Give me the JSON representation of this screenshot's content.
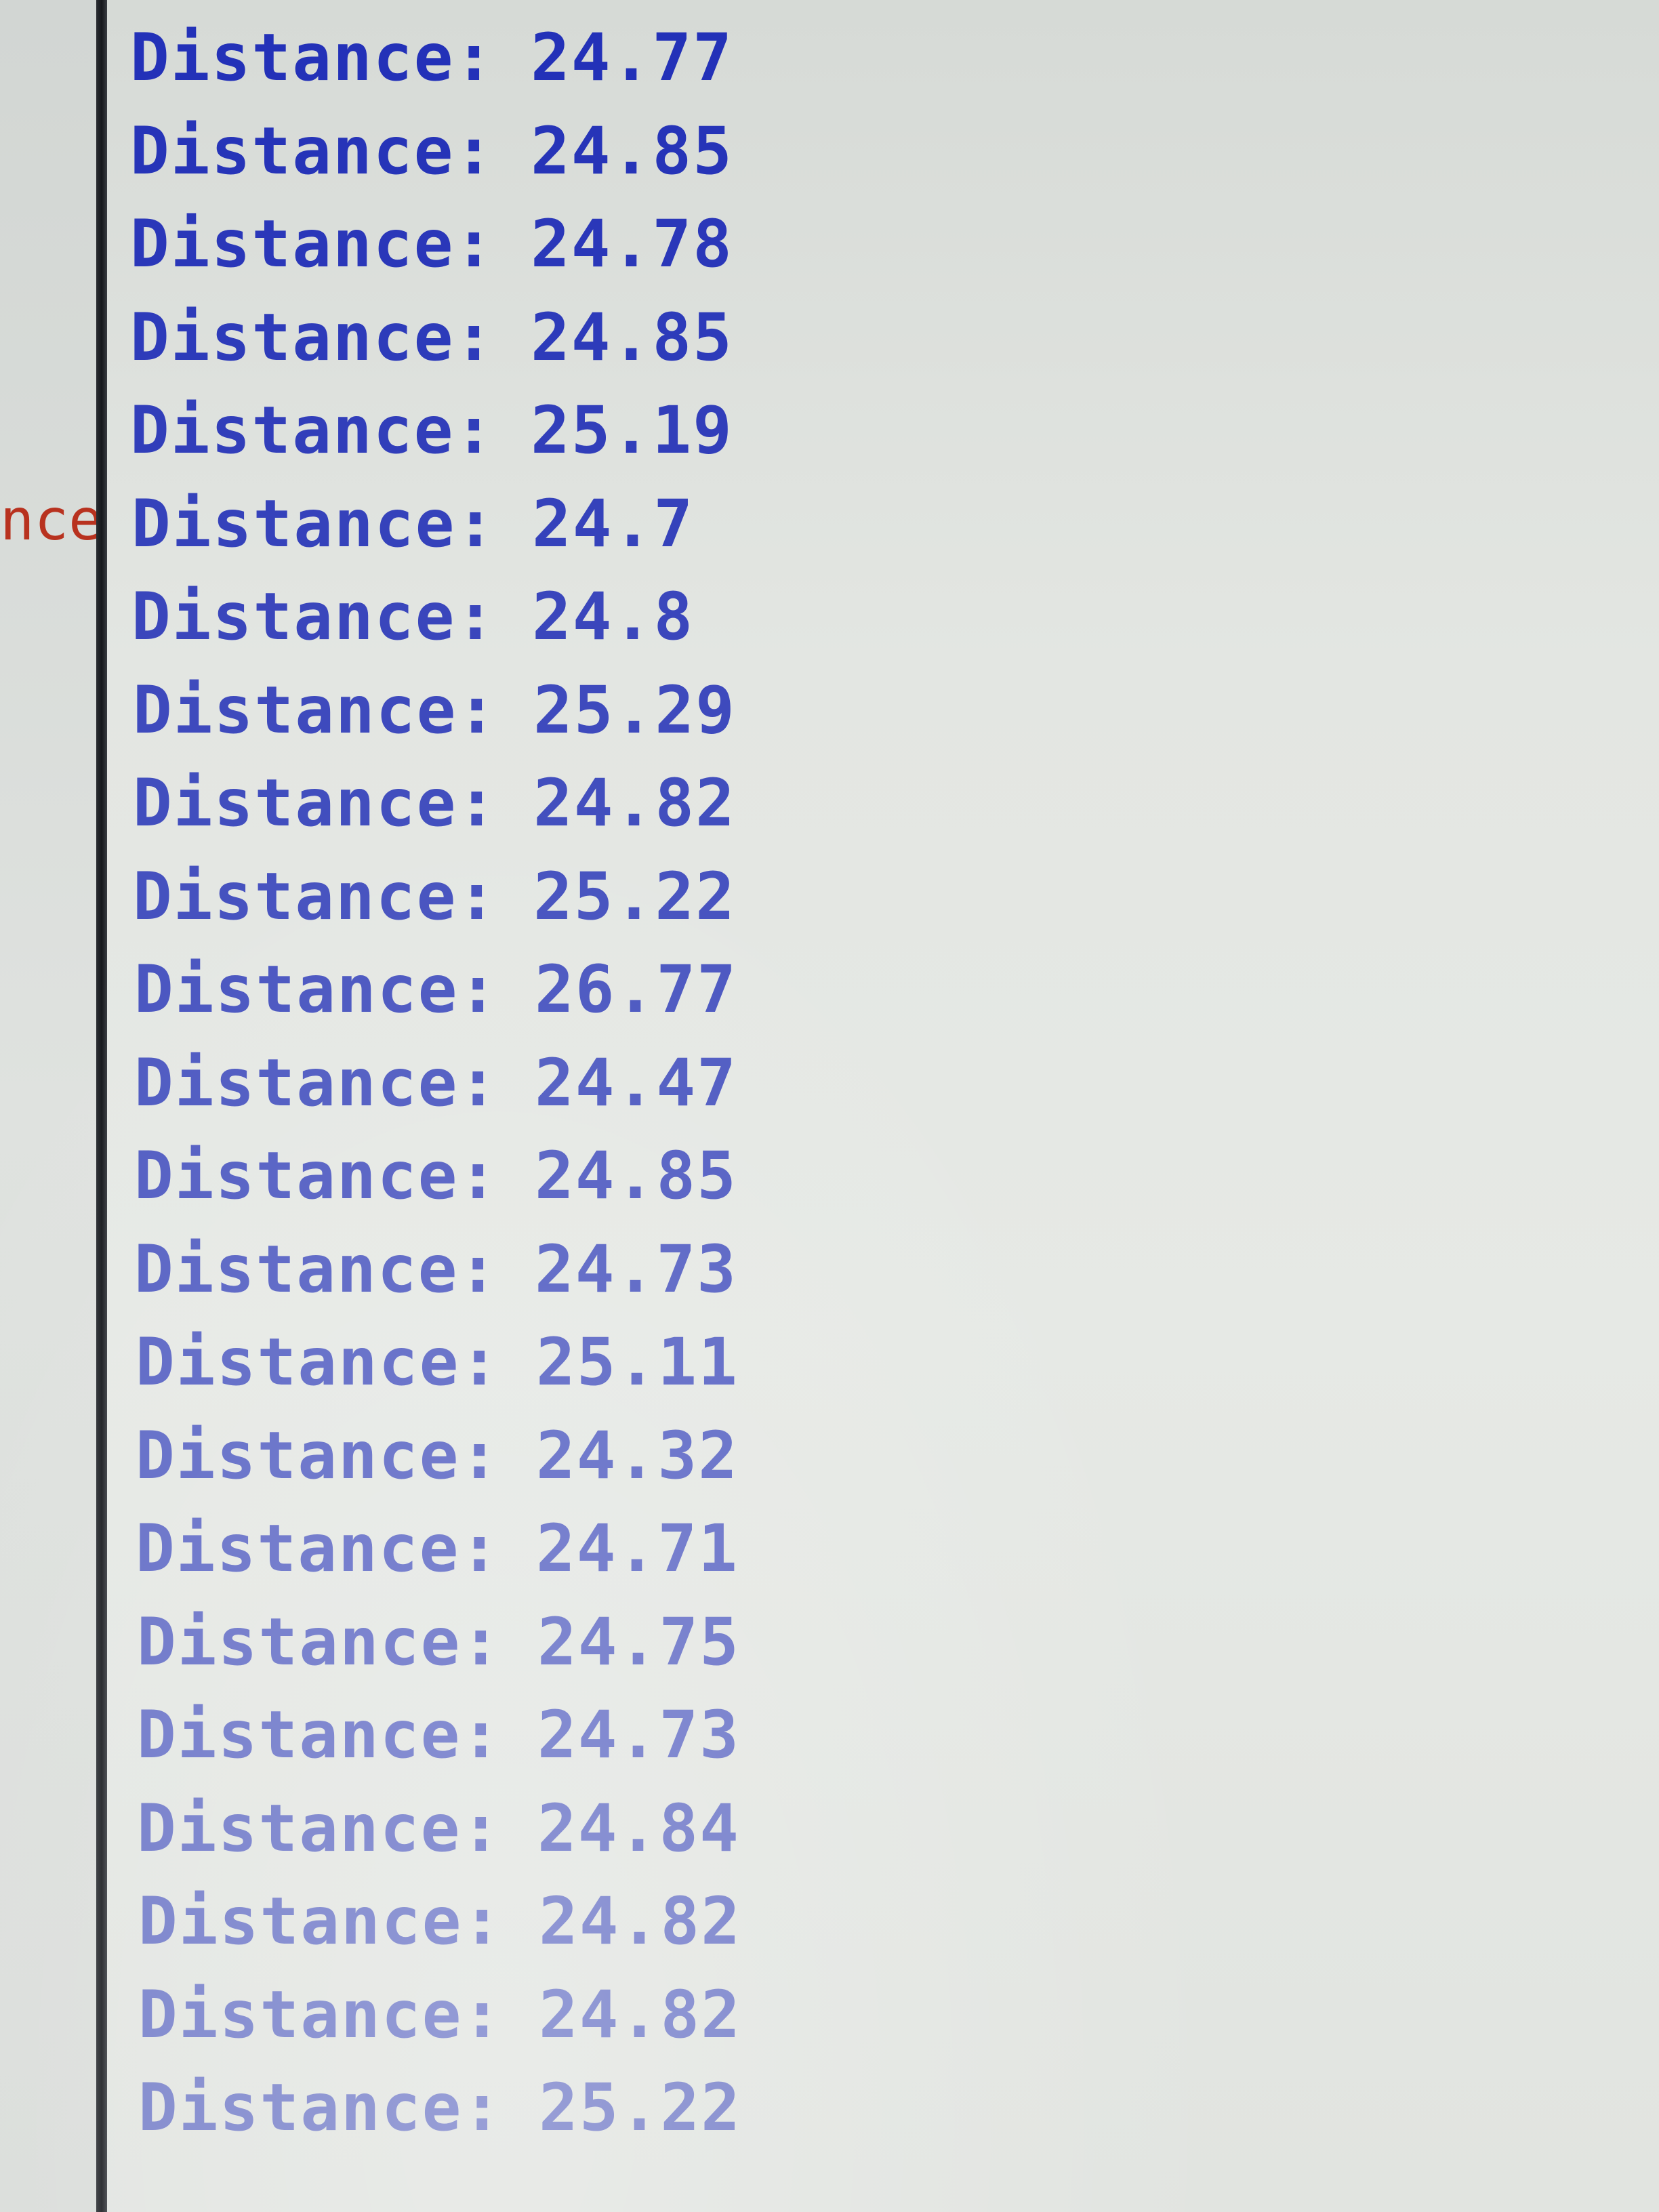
{
  "left_panel": {
    "partial_text": "nce"
  },
  "console": {
    "cutoff_line": "Dista",
    "label": "Distance:",
    "lines": [
      {
        "label": "Distance:",
        "value": "24.77"
      },
      {
        "label": "Distance:",
        "value": "24.85"
      },
      {
        "label": "Distance:",
        "value": "24.78"
      },
      {
        "label": "Distance:",
        "value": "24.85"
      },
      {
        "label": "Distance:",
        "value": "25.19"
      },
      {
        "label": "Distance:",
        "value": "24.7"
      },
      {
        "label": "Distance:",
        "value": "24.8"
      },
      {
        "label": "Distance:",
        "value": "25.29"
      },
      {
        "label": "Distance:",
        "value": "24.82"
      },
      {
        "label": "Distance:",
        "value": "25.22"
      },
      {
        "label": "Distance:",
        "value": "26.77"
      },
      {
        "label": "Distance:",
        "value": "24.47"
      },
      {
        "label": "Distance:",
        "value": "24.85"
      },
      {
        "label": "Distance:",
        "value": "24.73"
      },
      {
        "label": "Distance:",
        "value": "25.11"
      },
      {
        "label": "Distance:",
        "value": "24.32"
      },
      {
        "label": "Distance:",
        "value": "24.71"
      },
      {
        "label": "Distance:",
        "value": "24.75"
      },
      {
        "label": "Distance:",
        "value": "24.73"
      },
      {
        "label": "Distance:",
        "value": "24.84"
      },
      {
        "label": "Distance:",
        "value": "24.82"
      },
      {
        "label": "Distance:",
        "value": "24.82"
      },
      {
        "label": "Distance:",
        "value": "25.22"
      }
    ]
  },
  "colors": {
    "console_text": "#2331b8",
    "left_panel_text": "#b8321f",
    "divider": "#1c1e22",
    "background": "#e3e6e2"
  }
}
